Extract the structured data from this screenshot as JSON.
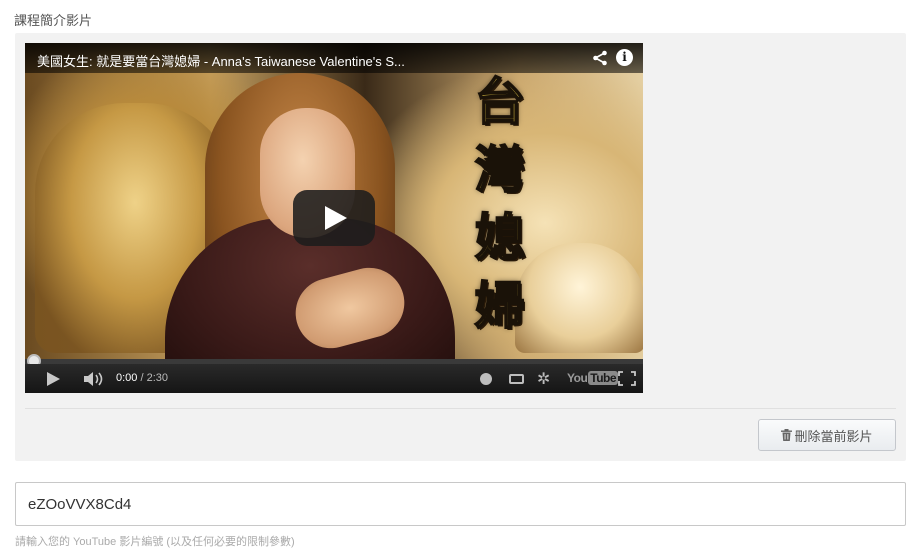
{
  "section": {
    "label": "課程簡介影片"
  },
  "player": {
    "video_title": "美國女生: 就是要當台灣媳婦 - Anna's Taiwanese Valentine's S...",
    "overlay_text": [
      "台",
      "灣",
      "媳",
      "婦"
    ],
    "time_current": "0:00",
    "time_separator": " / ",
    "time_total": "2:30",
    "progress_fraction": 0,
    "logo_you": "You",
    "logo_tube": "Tube",
    "info_glyph": "i",
    "gear_glyph": "✲",
    "icons": [
      "share-icon",
      "info-icon",
      "play-icon",
      "volume-icon",
      "clock-icon",
      "captions-icon",
      "settings-gear-icon",
      "youtube-logo",
      "fullscreen-icon"
    ]
  },
  "actions": {
    "delete_label": "刪除當前影片"
  },
  "video_id_field": {
    "value": "eZOoVVX8Cd4"
  },
  "help": {
    "text": "請輸入您的 YouTube 影片編號 (以及任何必要的限制參數)"
  },
  "colors": {
    "panel_bg": "#f2f2f2",
    "overlay_text": "#f5d64a",
    "controls_bg": "#1a1a1a"
  }
}
